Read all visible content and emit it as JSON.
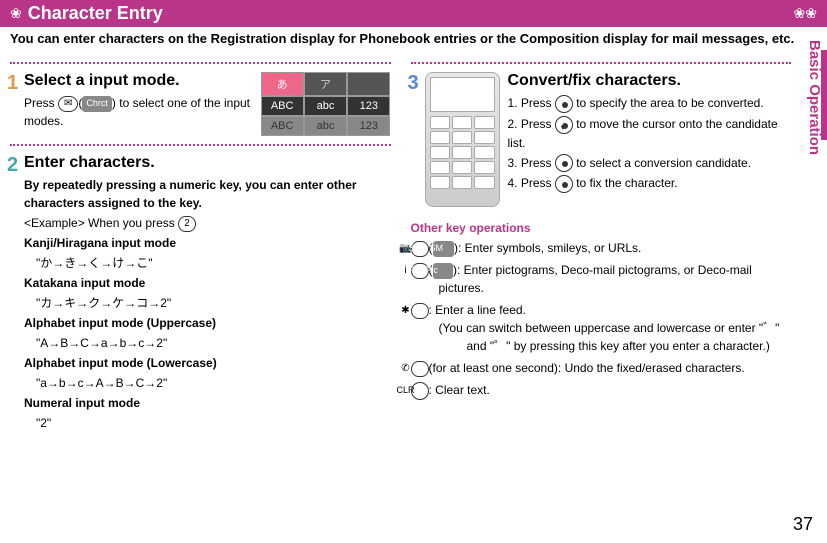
{
  "header": {
    "title": "Character Entry"
  },
  "intro": "You can enter characters on the Registration display for Phonebook entries or the Composition display for mail messages, etc.",
  "side_tab": "Basic Operation",
  "page_number": "37",
  "step1": {
    "num": "1",
    "title": "Select a input mode.",
    "press": "Press ",
    "key_label": "Chrct",
    "desc_tail": ") to select one of the input modes."
  },
  "mode_tabs": {
    "r1": [
      "あ",
      "ア",
      ""
    ],
    "r2": [
      "ABC",
      "abc",
      "123"
    ],
    "r3": [
      "ABC",
      "abc",
      "123"
    ]
  },
  "step2": {
    "num": "2",
    "title": "Enter characters.",
    "lead": "By repeatedly pressing a numeric key, you can enter other characters assigned to the key.",
    "example_label": "<Example> When you press ",
    "example_key": "2",
    "modes": [
      {
        "name": "Kanji/Hiragana input mode",
        "seq": "\"か→き→く→け→こ\""
      },
      {
        "name": "Katakana input mode",
        "seq": "\"カ→キ→ク→ケ→コ→2\""
      },
      {
        "name": "Alphabet input mode (Uppercase)",
        "seq": "\"A→B→C→a→b→c→2\""
      },
      {
        "name": "Alphabet input mode (Lowercase)",
        "seq": "\"a→b→c→A→B→C→2\""
      },
      {
        "name": "Numeral input mode",
        "seq": "\"2\""
      }
    ]
  },
  "step3": {
    "num": "3",
    "title": "Convert/fix characters.",
    "items": [
      {
        "n": "1.",
        "pre": "Press ",
        "post": " to specify the area to be converted."
      },
      {
        "n": "2.",
        "pre": "Press ",
        "post": " to move the cursor onto the candidate list."
      },
      {
        "n": "3.",
        "pre": "Press ",
        "post": " to select a conversion candidate."
      },
      {
        "n": "4.",
        "pre": "Press ",
        "post": " to fix the character."
      }
    ]
  },
  "other": {
    "heading": "Other key operations",
    "items": [
      {
        "btn": "📷",
        "pill": "SB・SM",
        "desc": ": Enter symbols, smileys, or URLs."
      },
      {
        "btn": "i",
        "pill": "Pi・Pic",
        "desc": ": Enter pictograms, Deco-mail pictograms, or Deco-mail pictures.",
        "cont": "Deco-mail pictures."
      },
      {
        "btn": "✱",
        "desc": ": Enter a line feed.",
        "extra": "(You can switch between uppercase and lowercase or enter \"゛\" and \"゜\" by pressing this key after you enter a character.)"
      },
      {
        "btn": "✆",
        "desc": "(for at least one second): Undo the fixed/erased characters."
      },
      {
        "btn": "CLR",
        "desc": ": Clear text."
      }
    ]
  }
}
